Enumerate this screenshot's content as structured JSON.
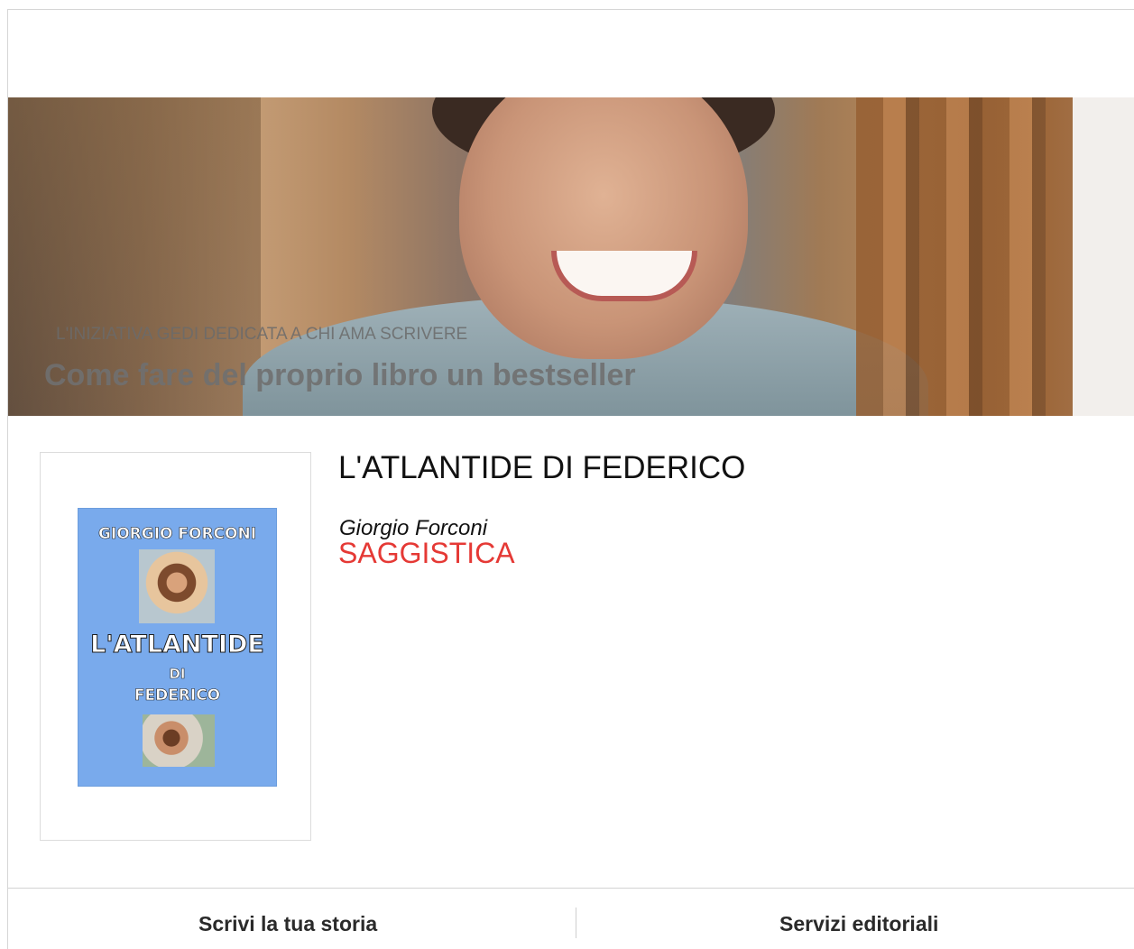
{
  "hero": {
    "kicker": "L'INIZIATIVA GEDI DEDICATA A CHI AMA SCRIVERE",
    "headline": "Come fare del proprio libro un bestseller"
  },
  "book": {
    "title": "L'ATLANTIDE DI FEDERICO",
    "author": "Giorgio Forconi",
    "genre": "SAGGISTICA",
    "cover": {
      "author": "GIORGIO FORCONI",
      "title": "L'ATLANTIDE",
      "di": "DI",
      "name": "FEDERICO",
      "background_color": "#79aaec"
    }
  },
  "footer": {
    "left_link": "Scrivi la tua storia",
    "right_link": "Servizi editoriali"
  },
  "colors": {
    "genre": "#e53935",
    "text": "#111111"
  }
}
